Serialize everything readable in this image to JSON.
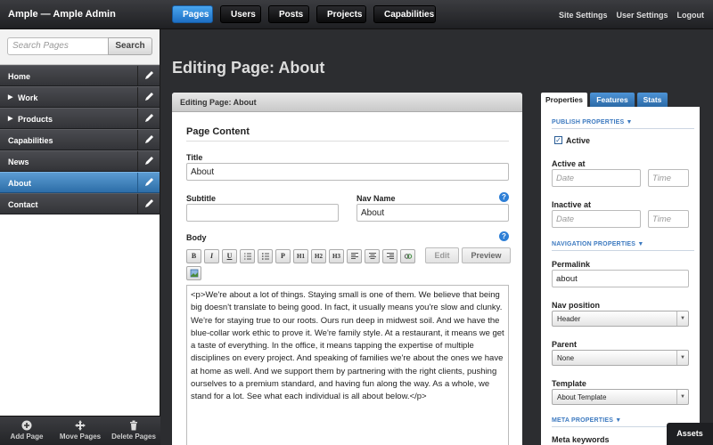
{
  "app": {
    "title": "Ample — Ample Admin"
  },
  "nav": {
    "items": [
      "Pages",
      "Users",
      "Posts",
      "Projects",
      "Capabilities"
    ],
    "links": [
      "Site Settings",
      "User Settings",
      "Logout"
    ]
  },
  "sidebar": {
    "search_placeholder": "Search Pages",
    "search_button": "Search",
    "items": [
      "Home",
      "Work",
      "Products",
      "Capabilities",
      "News",
      "About",
      "Contact"
    ],
    "footer": [
      "Add Page",
      "Move Pages",
      "Delete Pages"
    ]
  },
  "main": {
    "page_title": "Editing Page: About",
    "panel_header": "Editing Page: About",
    "section_title": "Page Content",
    "title_label": "Title",
    "title_value": "About",
    "subtitle_label": "Subtitle",
    "subtitle_value": "",
    "navname_label": "Nav Name",
    "navname_value": "About",
    "body_label": "Body",
    "toolbar": [
      "B",
      "I",
      "U",
      "H1",
      "H2",
      "H3"
    ],
    "edit_button": "Edit",
    "preview_button": "Preview",
    "body_text": "<p>We're about a lot of things. Staying small is one of them. We believe that being big doesn't translate to being good. In fact, it usually means you're slow and clunky. We're for staying true to our roots. Ours run deep in midwest soil. And we have the blue-collar work ethic to prove it. We're family style. At a restaurant, it means we get a taste of everything. In the office, it means tapping the expertise of multiple disciplines on every project. And speaking of families we're about the ones we have at home as well. And we support them by partnering with the right clients, pushing ourselves to a premium standard, and having fun along the way. As a whole, we stand for a lot. See what each individual is all about below.</p>"
  },
  "props": {
    "tabs": [
      "Properties",
      "Features",
      "Stats"
    ],
    "publish_section": "PUBLISH PROPERTIES",
    "active_label": "Active",
    "active_at_label": "Active at",
    "inactive_at_label": "Inactive at",
    "date_placeholder": "Date",
    "time_placeholder": "Time",
    "nav_section": "NAVIGATION PROPERTIES",
    "permalink_label": "Permalink",
    "permalink_value": "about",
    "navpos_label": "Nav position",
    "navpos_value": "Header",
    "parent_label": "Parent",
    "parent_value": "None",
    "template_label": "Template",
    "template_value": "About Template",
    "meta_section": "META PROPERTIES",
    "meta_keywords_label": "Meta keywords"
  },
  "assets_label": "Assets",
  "colors": {
    "accent": "#2e7fd6",
    "selected": "#3f82bd",
    "dark": "#2c2d30"
  }
}
